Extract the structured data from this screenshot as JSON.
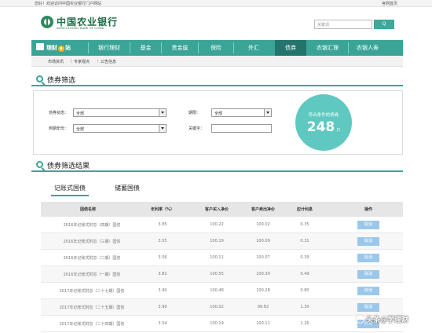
{
  "topbar": {
    "greeting": "您好！欢迎访问中国农业银行门户网站",
    "home_link": "官网首页"
  },
  "logo": {
    "name_cn": "中国农业银行",
    "name_en": "AGRICULTURAL BANK OF CHINA"
  },
  "search": {
    "placeholder": "关键词",
    "button": "Q"
  },
  "nav": {
    "logo_label_1": "理财",
    "logo_label_e": "e",
    "logo_label_2": "站",
    "items": [
      "银行理财",
      "基金",
      "贵金属",
      "保险",
      "外汇",
      "债券",
      "农银汇理",
      "农银人寿"
    ],
    "active_index": 5
  },
  "subnav": {
    "items": [
      "市场资讯",
      "专家视点",
      "公告信息"
    ]
  },
  "filter_section": {
    "title": "债券筛选"
  },
  "filter": {
    "bond_status_label": "债券状态：",
    "bond_status_value": "全部",
    "term_label": "期限：",
    "term_value": "全部",
    "maturity_label": "到期年份：",
    "maturity_value": "全部",
    "keyword_label": "关键字：",
    "keyword_value": ""
  },
  "result_count": {
    "caption": "符合条件的债券",
    "count": "248",
    "unit": "只"
  },
  "results_section": {
    "title": "债券筛选结果"
  },
  "tabs": [
    "记账式国债",
    "储蓄国债"
  ],
  "table": {
    "headers": [
      "国债名称",
      "年利率（%）",
      "客户买入净价",
      "客户卖出净价",
      "应计利息",
      "操作"
    ],
    "rows": [
      [
        "2016年记账式附息（四期）国债",
        "3.85",
        "100.22",
        "100.02",
        "0.35",
        "取消"
      ],
      [
        "2016年记账式附息（三期）国债",
        "3.55",
        "100.19",
        "100.09",
        "0.31",
        "取消"
      ],
      [
        "2016年记账式附息（二期）国债",
        "3.56",
        "100.11",
        "100.07",
        "0.39",
        "取消"
      ],
      [
        "2016年记账式附息（一期）国债",
        "3.81",
        "100.55",
        "100.39",
        "0.49",
        "取消"
      ],
      [
        "2017年记账式附息（二十七期）国债",
        "3.90",
        "100.48",
        "100.28",
        "0.80",
        "取消"
      ],
      [
        "2017年记账式附息（二十五期）国债",
        "3.90",
        "100.02",
        "99.82",
        "1.30",
        "取消"
      ],
      [
        "2017年记账式附息（二十四期）国债",
        "3.54",
        "100.19",
        "100.11",
        "1.26",
        "取消"
      ]
    ]
  },
  "watermark": "头条@学理财"
}
